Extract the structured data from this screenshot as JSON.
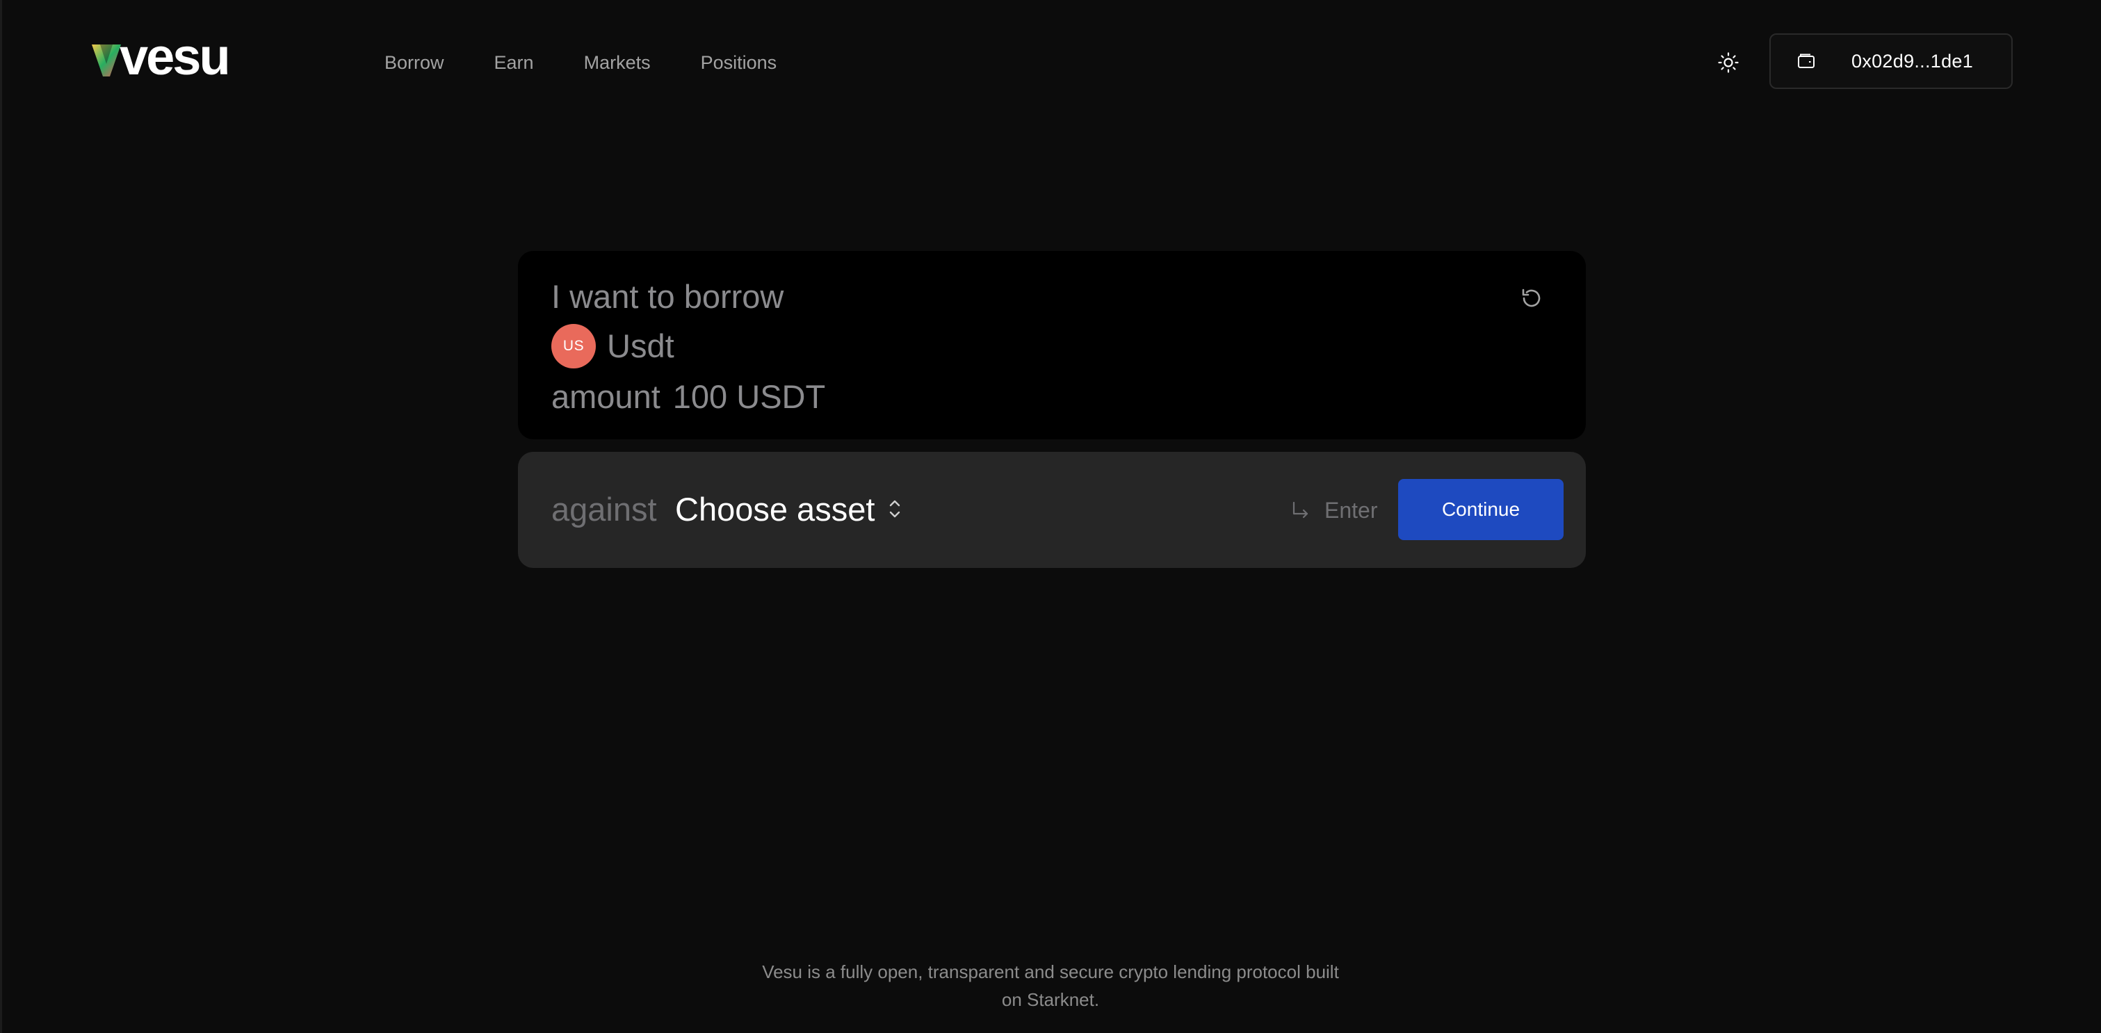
{
  "brand": {
    "name": "vesu",
    "logo_colors": [
      "#f2c94c",
      "#27ae60",
      "#eb5757"
    ]
  },
  "nav": {
    "items": [
      {
        "label": "Borrow"
      },
      {
        "label": "Earn"
      },
      {
        "label": "Markets"
      },
      {
        "label": "Positions"
      }
    ]
  },
  "header": {
    "theme_icon": "sun-icon",
    "wallet": {
      "icon": "wallet-icon",
      "address": "0x02d9...1de1"
    }
  },
  "borrow": {
    "title": "I want to borrow",
    "reset_icon": "reset-icon",
    "asset": {
      "badge": "US",
      "badge_color": "#e96a5b",
      "name": "Usdt"
    },
    "amount_label": "amount",
    "amount_value": "100 USDT"
  },
  "against": {
    "label": "against",
    "select_text": "Choose asset",
    "enter_hint": "Enter",
    "continue_label": "Continue",
    "accent_color": "#1e4ac0"
  },
  "footer": {
    "line1": "Vesu is a fully open, transparent and secure crypto lending protocol built",
    "line2": "on Starknet."
  }
}
